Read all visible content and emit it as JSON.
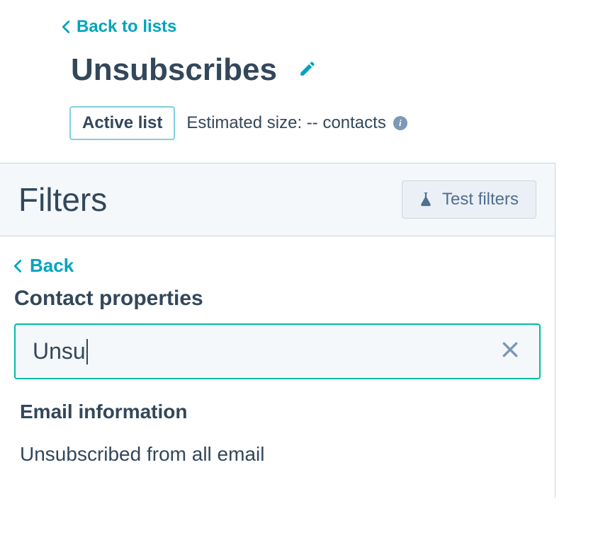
{
  "nav": {
    "back_to_lists_label": "Back to lists"
  },
  "header": {
    "title": "Unsubscribes",
    "list_type_badge": "Active list",
    "estimated_size_label": "Estimated size: -- contacts"
  },
  "filters": {
    "title": "Filters",
    "test_button_label": "Test filters",
    "back_label": "Back",
    "section_heading": "Contact properties",
    "search_value": "Unsu",
    "group_heading": "Email information",
    "results": [
      {
        "label": "Unsubscribed from all email"
      }
    ]
  }
}
